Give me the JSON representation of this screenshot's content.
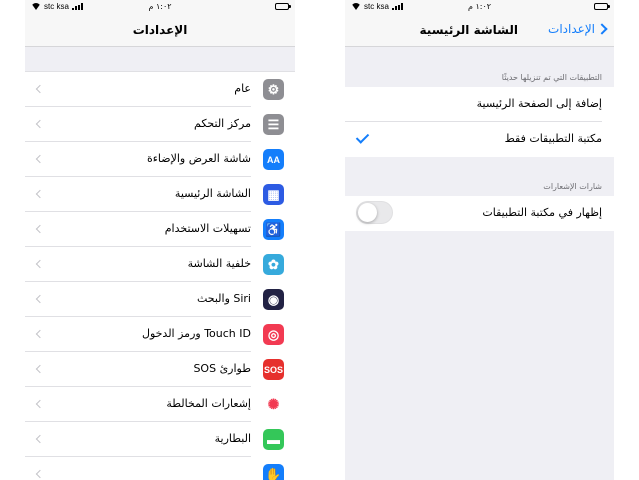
{
  "status_bar": {
    "carrier": "stc ksa",
    "time": "١:٠٢ م"
  },
  "left": {
    "title": "الإعدادات",
    "items": [
      {
        "label": "عام",
        "icon": "gear-icon",
        "color": "#8e8e93",
        "glyph": "⚙"
      },
      {
        "label": "مركز التحكم",
        "icon": "control-center-icon",
        "color": "#8e8e93",
        "glyph": "☰"
      },
      {
        "label": "شاشة العرض والإضاءة",
        "icon": "display-brightness-icon",
        "color": "#147efb",
        "glyph": "AA"
      },
      {
        "label": "الشاشة الرئيسية",
        "icon": "home-screen-icon",
        "color": "#2d5be3",
        "glyph": "▦"
      },
      {
        "label": "تسهيلات الاستخدام",
        "icon": "accessibility-icon",
        "color": "#147efb",
        "glyph": "♿"
      },
      {
        "label": "خلفية الشاشة",
        "icon": "wallpaper-icon",
        "color": "#36aadc",
        "glyph": "✿"
      },
      {
        "label": "Siri والبحث",
        "icon": "siri-icon",
        "color": "#222244",
        "glyph": "◉"
      },
      {
        "label": "Touch ID ورمز الدخول",
        "icon": "fingerprint-icon",
        "color": "#f23a52",
        "glyph": "◎"
      },
      {
        "label": "طوارئ SOS",
        "icon": "sos-icon",
        "color": "#e6302d",
        "glyph": "SOS"
      },
      {
        "label": "إشعارات المخالطة",
        "icon": "exposure-notification-icon",
        "color": "#ffffff",
        "glyph": "✺"
      },
      {
        "label": "البطارية",
        "icon": "battery-icon",
        "color": "#34c759",
        "glyph": "▬"
      },
      {
        "label": "",
        "icon": "privacy-hand-icon",
        "color": "#147efb",
        "glyph": "✋"
      }
    ]
  },
  "right": {
    "title": "الشاشة الرئيسية",
    "back_label": "الإعدادات",
    "section1_header": "التطبيقات التي تم تنزيلها حديثًا",
    "option_add": "إضافة إلى الصفحة الرئيسية",
    "option_library": "مكتبة التطبيقات فقط",
    "selected_option": "option_library",
    "section2_header": "شارات الإشعارات",
    "toggle_label": "إظهار في مكتبة التطبيقات",
    "toggle_on": false,
    "accent_color": "#147efb"
  }
}
